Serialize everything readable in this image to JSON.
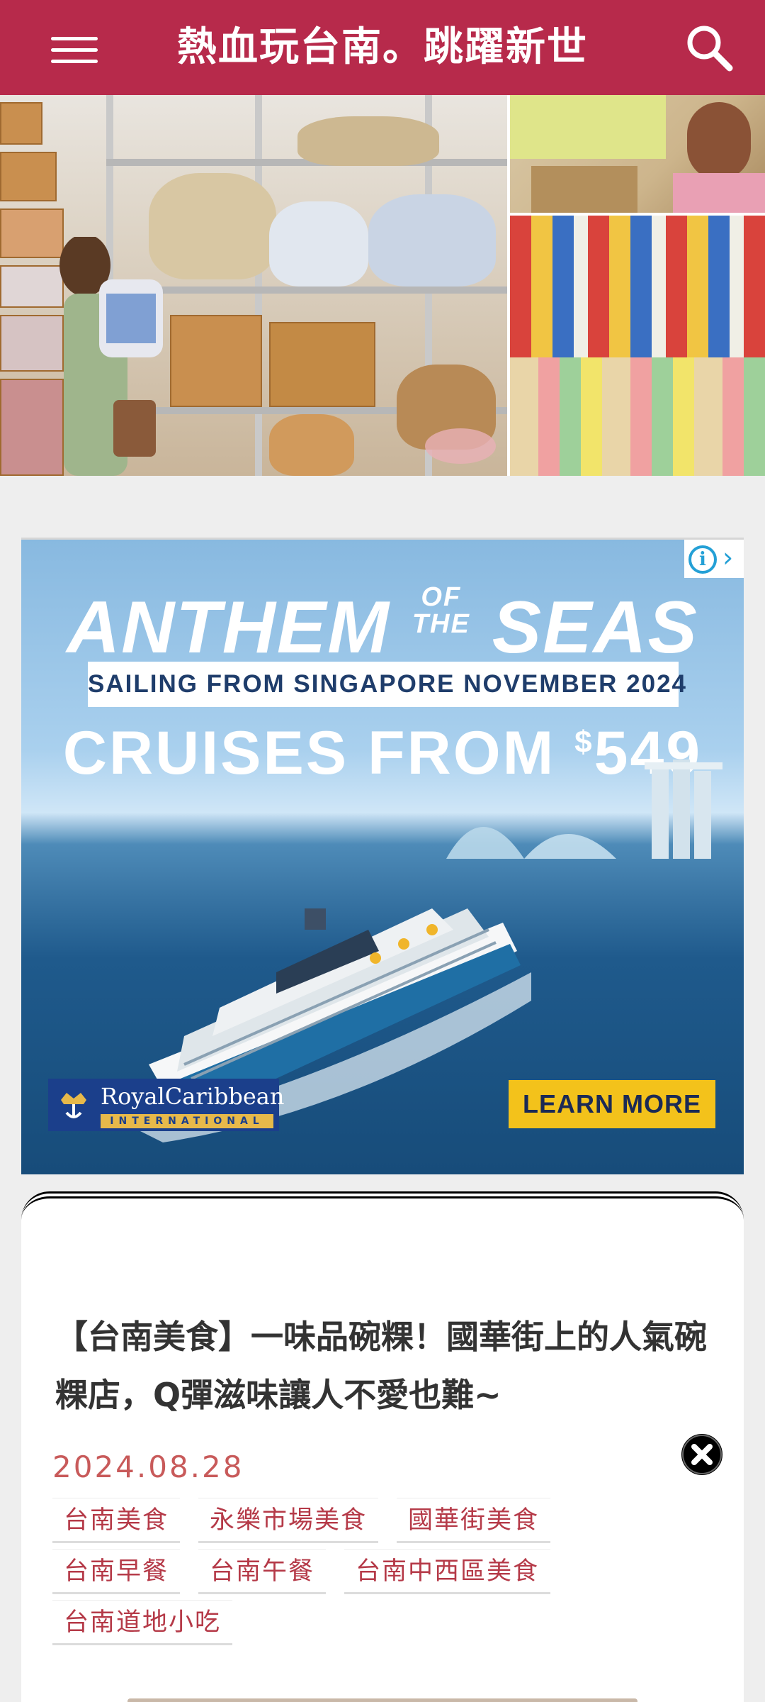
{
  "header": {
    "site_title": "熱血玩台南。跳躍新世",
    "menu_icon": "hamburger-menu-icon",
    "search_icon": "search-icon",
    "background_color": "#b72a4b"
  },
  "hero": {
    "watermark_icon": "site-mascot-logo"
  },
  "ad": {
    "headline_left": "ANTHEM",
    "headline_of": "OF",
    "headline_the": "THE",
    "headline_right": "SEAS",
    "sailing_text": "SAILING FROM SINGAPORE NOVEMBER 2024",
    "price_prefix": "CRUISES FROM ",
    "price_currency": "$",
    "price_value": "549",
    "brand_name": "RoyalCaribbean",
    "brand_sub": "INTERNATIONAL",
    "cta_label": "LEARN MORE",
    "info_icon": "ad-info-icon",
    "close_icon": "ad-close-icon",
    "cta_color": "#f3c21b"
  },
  "article": {
    "title": "【台南美食】一味品碗粿！國華街上的人氣碗粿店，Q彈滋味讓人不愛也難~",
    "date": "2024.08.28",
    "date_color": "#c85a5a",
    "tags_row1": [
      "台南美食",
      "永樂市場美食",
      "國華街美食"
    ],
    "tags_row2": [
      "台南早餐",
      "台南午餐",
      "台南中西區美食"
    ],
    "tags_row3": [
      "台南道地小吃"
    ]
  },
  "floating": {
    "close_icon": "close-circle-icon"
  }
}
